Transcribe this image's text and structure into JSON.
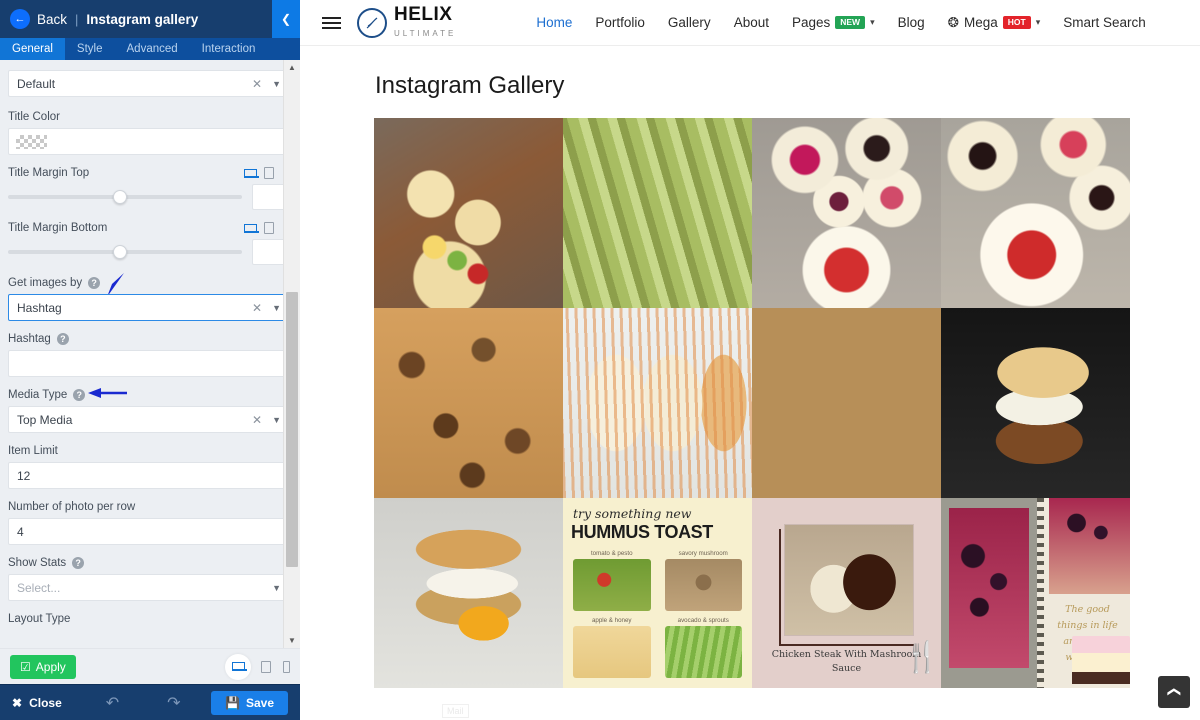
{
  "sidebar": {
    "header": {
      "back_label": "Back",
      "separator": "|",
      "title": "Instagram gallery",
      "collapse_icon": "chevron-left-icon"
    },
    "tabs": [
      {
        "label": "General",
        "active": true
      },
      {
        "label": "Style",
        "active": false
      },
      {
        "label": "Advanced",
        "active": false
      },
      {
        "label": "Interaction",
        "active": false
      }
    ],
    "fields": {
      "preset": {
        "value": "Default"
      },
      "title_color": {
        "label": "Title Color",
        "value": "transparent"
      },
      "title_margin_top": {
        "label": "Title Margin Top",
        "value": ""
      },
      "title_margin_bottom": {
        "label": "Title Margin Bottom",
        "value": ""
      },
      "get_images_by": {
        "label": "Get images by",
        "value": "Hashtag"
      },
      "hashtag": {
        "label": "Hashtag",
        "value": ""
      },
      "media_type": {
        "label": "Media Type",
        "value": "Top Media"
      },
      "item_limit": {
        "label": "Item Limit",
        "value": "12"
      },
      "photo_per_row": {
        "label": "Number of photo per row",
        "value": "4"
      },
      "show_stats": {
        "label": "Show Stats",
        "placeholder": "Select..."
      },
      "layout_type": {
        "label": "Layout Type"
      }
    },
    "apply_bar": {
      "apply_label": "Apply",
      "devices": [
        "desktop-icon",
        "tablet-icon",
        "mobile-icon"
      ]
    },
    "footer": {
      "close_label": "Close",
      "undo_icon": "undo-icon",
      "redo_icon": "redo-icon",
      "save_label": "Save"
    }
  },
  "preview": {
    "nav": {
      "menu_icon": "hamburger-icon",
      "logo_main": "HELIX",
      "logo_sub": "ULTIMATE",
      "items": [
        {
          "label": "Home",
          "active": true
        },
        {
          "label": "Portfolio",
          "active": false
        },
        {
          "label": "Gallery",
          "active": false
        },
        {
          "label": "About",
          "active": false
        },
        {
          "label": "Pages",
          "active": false,
          "badge": "NEW",
          "badge_color": "#23a455",
          "dropdown": true
        },
        {
          "label": "Blog",
          "active": false
        },
        {
          "label": "Mega",
          "active": false,
          "badge": "HOT",
          "badge_color": "#e3232a",
          "dropdown": true,
          "icon": "cube-icon"
        },
        {
          "label": "Smart Search",
          "active": false
        }
      ]
    },
    "page_title": "Instagram Gallery",
    "gallery": {
      "columns": 4,
      "items": [
        {
          "alt": "fruit tarts on wooden board",
          "art": "p1"
        },
        {
          "alt": "grilled parmesan zucchini spears",
          "art": "p2"
        },
        {
          "alt": "mini cheesecakes with berries",
          "art": "p3"
        },
        {
          "alt": "cheesecake bites with strawberry",
          "art": "p4"
        },
        {
          "alt": "creamy mushroom chicken skillet",
          "art": "p5"
        },
        {
          "alt": "mexican street corn elote",
          "art": "p6"
        },
        {
          "alt": "breakfast brunch board",
          "art": "p7"
        },
        {
          "alt": "double cheeseburger on brioche",
          "art": "p8"
        },
        {
          "alt": "pancake egg bacon sandwich",
          "art": "p9"
        },
        {
          "alt": "hummus toast recipe card",
          "art": "toast"
        },
        {
          "alt": "chicken steak with mushroom sauce",
          "art": "steak"
        },
        {
          "alt": "blueberry cheesecake photo book",
          "art": "book"
        }
      ],
      "toast_card": {
        "script_line": "try something new",
        "title": "HUMMUS TOAST",
        "items": [
          "tomato & pesto",
          "savory mushroom",
          "apple & honey",
          "avocado & sprouts"
        ]
      },
      "steak_card": {
        "caption": "Chicken Steak With Mashroom Sauce"
      },
      "book_card": {
        "quote": "The good things in life are better with you."
      }
    },
    "scroll_top_icon": "chevron-up-icon",
    "mail_ghost": "Mail"
  }
}
